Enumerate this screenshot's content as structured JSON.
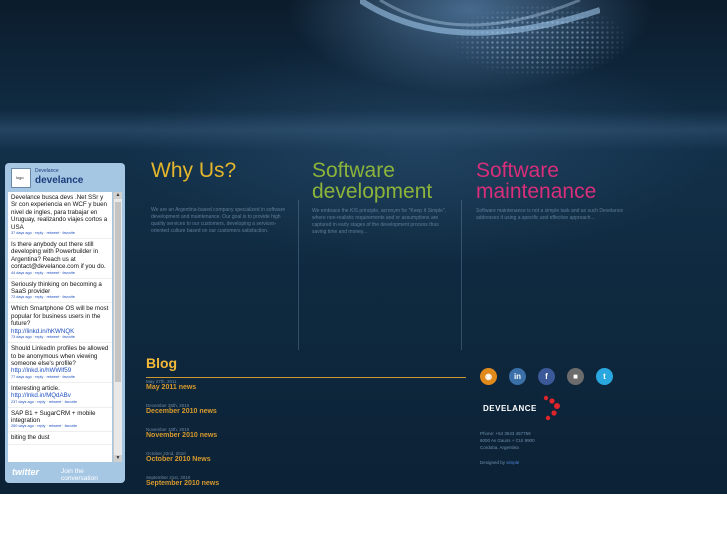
{
  "columns": [
    {
      "title": "Why Us?",
      "color": "#e4b62b",
      "text": "We are an Argentina-based company specialized in software development and maintenance. Our goal is to provide high quality services to our customers, developing a services-oriented culture based on our customers satisfaction."
    },
    {
      "title": "Software development",
      "color": "#8db43a",
      "text": "We embrace the KIS principle, acronym for \"Keep It Simple\", where non-realistic requirements and or assumptions are captured in early stages of the development process thus saving time and money..."
    },
    {
      "title": "Software maintenance",
      "color": "#d92e7a",
      "text": "Software maintenance is not a simple task and as such Develance addresses it using a specific and effective approach..."
    }
  ],
  "twitter": {
    "account_small": "Develance",
    "account_name": "develance",
    "avatar_text": "logo",
    "tweets": [
      {
        "text": "Develance busca devs .Net SSr y Sr con experiencia en WCF y buen nivel de ingles, para trabajar en Uruguay, realizando viajes cortos a USA",
        "link": "",
        "meta": "37 days ago · reply · retweet · favorite"
      },
      {
        "text": "Is there anybody out there still developing with Powerbuilder in Argentina? Reach us at contact@develance.com if you do.",
        "link": "",
        "meta": "44 days ago · reply · retweet · favorite"
      },
      {
        "text": "Seriously thinking on becoming a SaaS provider",
        "link": "",
        "meta": "72 days ago · reply · retweet · favorite"
      },
      {
        "text": "Which Smartphone OS will be most popular for business users in the future?",
        "link": "http://linkd.in/hKWNQK",
        "meta": "73 days ago · reply · retweet · favorite"
      },
      {
        "text": "Should LinkedIn profiles be allowed to be anonymous when viewing someone else's profile?",
        "link": "http://lnkd.in/hWWlf59",
        "meta": "77 days ago · reply · retweet · favorite"
      },
      {
        "text": "Interesting article.",
        "link": "http://lnkd.in/MQdABv",
        "meta": "237 days ago · reply · retweet · favorite"
      },
      {
        "text": "SAP B1 + SugarCRM + mobile integration",
        "link": "",
        "meta": "260 days ago · reply · retweet · favorite"
      },
      {
        "text": "biting the dust",
        "link": "",
        "meta": ""
      }
    ],
    "footer_logo": "twitter",
    "footer_join": "Join the conversation"
  },
  "blog": {
    "title": "Blog",
    "posts": [
      {
        "date": "May 27th, 2011",
        "title": "May 2011 news"
      },
      {
        "date": "December 26th, 2010",
        "title": "December 2010 news"
      },
      {
        "date": "November 10th, 2010",
        "title": "November 2010 news"
      },
      {
        "date": "October 22nd, 2010",
        "title": "October 2010 News"
      },
      {
        "date": "September 21st, 2010",
        "title": "September 2010 news"
      }
    ]
  },
  "social_icons": [
    {
      "name": "rss-icon",
      "color": "#e08a1c",
      "glyph": "◉"
    },
    {
      "name": "linkedin-icon",
      "color": "#3a6fa8",
      "glyph": "in"
    },
    {
      "name": "facebook-icon",
      "color": "#3b5998",
      "glyph": "f"
    },
    {
      "name": "delicious-icon",
      "color": "#6c6c6c",
      "glyph": "■"
    },
    {
      "name": "twitter-icon",
      "color": "#2aa7de",
      "glyph": "t"
    }
  ],
  "brand": {
    "name": "DEVELANCE",
    "phone": "Phone: +54 3543 457759",
    "address": "6000 Av Gauss + CUI 9900",
    "city": "Cordoba, Argentina",
    "designed": "Designed by",
    "designer": "simple"
  }
}
